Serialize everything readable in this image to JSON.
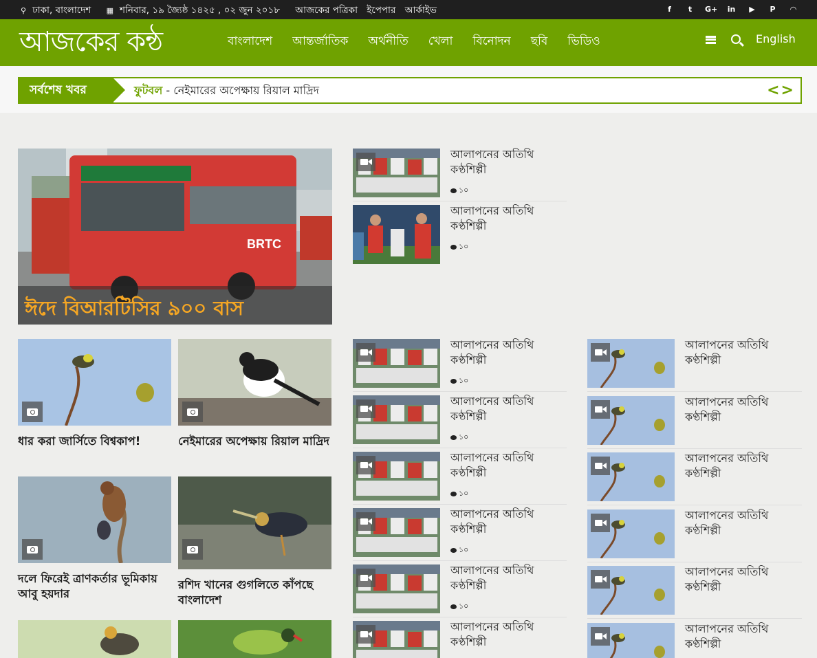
{
  "topbar": {
    "location": "ঢাকা, বাংলাদেশ",
    "date": "শনিবার, ১৯ জ্যৈষ্ঠ ১৪২৫ , ০২ জুন ২০১৮",
    "links": [
      "আজকের পত্রিকা",
      "ইপেপার",
      "আর্কাইভ"
    ],
    "social_icons": [
      "facebook-icon",
      "twitter-icon",
      "google-plus-icon",
      "linkedin-icon",
      "youtube-icon",
      "pinterest-icon",
      "rss-icon"
    ]
  },
  "header": {
    "logo": "আজকের কন্ঠ",
    "nav": [
      "বাংলাদেশ",
      "আন্তর্জাতিক",
      "অর্থনীতি",
      "খেলা",
      "বিনোদন",
      "ছবি",
      "ভিডিও"
    ],
    "language": "English"
  },
  "ticker": {
    "label": "সর্বশেষ খবর",
    "category": "ফুটবল",
    "separator": " - ",
    "headline": "নেইমারের অপেক্ষায় রিয়াল মাদ্রিদ",
    "arrows": "<>"
  },
  "lead": {
    "caption": "ঈদে বিআরটিসির ৯০০ বাস",
    "bus_sign": "BRTC"
  },
  "grid": [
    {
      "title": "ধার করা জার্সিতে বিশ্বকাপ!"
    },
    {
      "title": "নেইমারের অপেক্ষায় রিয়াল মাদ্রিদ"
    },
    {
      "title": "দলে ফিরেই ত্রাণকর্তার ভূমিকায় আবু হয়দার"
    },
    {
      "title": "রশিদ খানের গুগলিতে কাঁপছে বাংলাদেশ"
    }
  ],
  "top_list": [
    {
      "title": "আলাপনের অতিথি কণ্ঠশিল্পী",
      "comments": "১০"
    },
    {
      "title": "আলাপনের অতিথি কণ্ঠশিল্পী",
      "comments": "১০"
    }
  ],
  "mid_list": [
    {
      "title": "আলাপনের অতিথি কণ্ঠশিল্পী",
      "comments": "১০"
    },
    {
      "title": "আলাপনের অতিথি কণ্ঠশিল্পী",
      "comments": "১০"
    },
    {
      "title": "আলাপনের অতিথি কণ্ঠশিল্পী",
      "comments": "১০"
    },
    {
      "title": "আলাপনের অতিথি কণ্ঠশিল্পী",
      "comments": "১০"
    },
    {
      "title": "আলাপনের অতিথি কণ্ঠশিল্পী",
      "comments": "১০"
    },
    {
      "title": "আলাপনের অতিথি কণ্ঠশিল্পী",
      "comments": ""
    }
  ],
  "video_list": [
    {
      "title": "আলাপনের অতিথি কণ্ঠশিল্পী"
    },
    {
      "title": "আলাপনের অতিথি কণ্ঠশিল্পী"
    },
    {
      "title": "আলাপনের অতিথি কণ্ঠশিল্পী"
    },
    {
      "title": "আলাপনের অতিথি কণ্ঠশিল্পী"
    },
    {
      "title": "আলাপনের অতিথি কণ্ঠশিল্পী"
    },
    {
      "title": "আলাপনের অতিথি কণ্ঠশিল্পী"
    }
  ],
  "colors": {
    "brand": "#6fa200",
    "topbar": "#1f1f1f",
    "caption": "#f5a623"
  }
}
